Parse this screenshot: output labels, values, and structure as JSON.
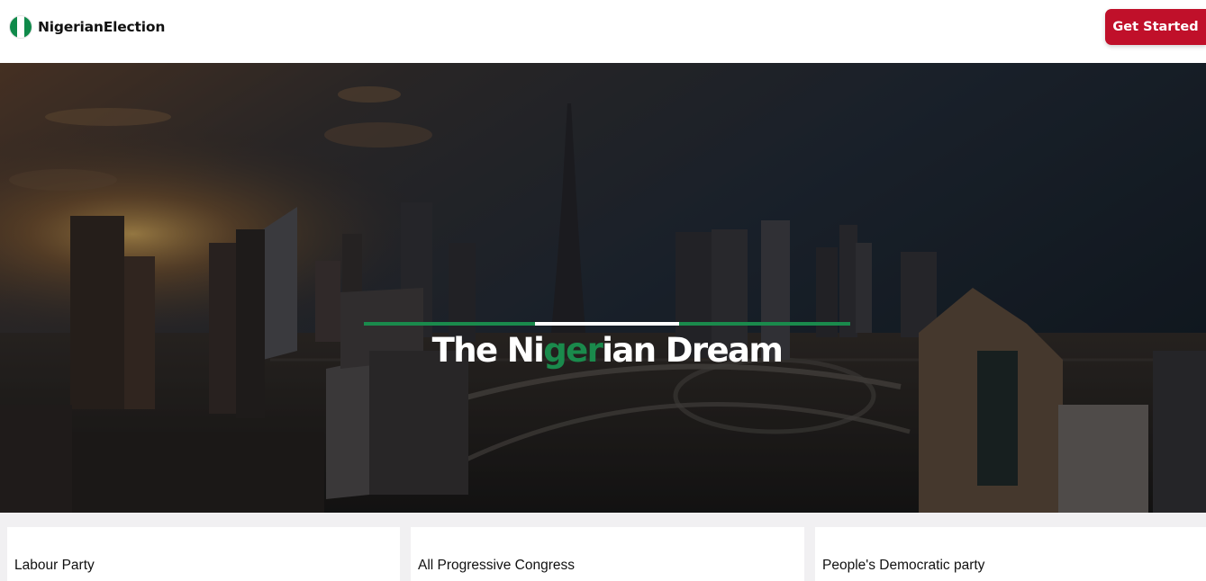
{
  "navbar": {
    "brand_name": "NigerianElection",
    "cta_label": "Get Started",
    "flag_colors": [
      "#0f8a4a",
      "#ffffff",
      "#0f8a4a"
    ]
  },
  "hero": {
    "title_pre": "The Ni",
    "title_accent": "ger",
    "title_post": "ian Dream",
    "accent_color": "#1a8a4c",
    "divider_colors": [
      "#1a8a4c",
      "#ffffff",
      "#1a8a4c"
    ]
  },
  "cards": [
    {
      "title": "Labour Party"
    },
    {
      "title": "All Progressive Congress"
    },
    {
      "title": "People's Democratic party"
    }
  ],
  "colors": {
    "cta_background": "#c0102a",
    "page_background": "#f1f0f2"
  }
}
